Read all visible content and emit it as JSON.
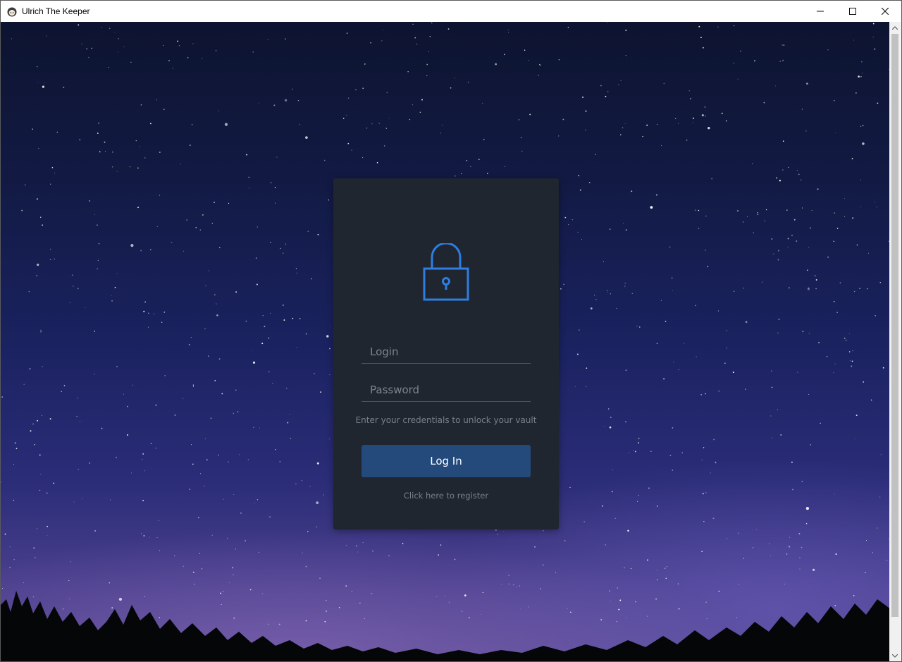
{
  "window": {
    "title": "Ulrich The Keeper",
    "controls": {
      "minimize_icon": "minimize-icon",
      "maximize_icon": "maximize-icon",
      "close_icon": "close-icon"
    }
  },
  "login_card": {
    "lock_icon": "lock-icon",
    "accent_color": "#2f7de1",
    "login_placeholder": "Login",
    "login_value": "",
    "password_placeholder": "Password",
    "password_value": "",
    "hint": "Enter your credentials to unlock your vault",
    "submit_label": "Log In",
    "register_link": "Click here to register"
  },
  "colors": {
    "card_background": "#1f262f",
    "button_background": "#234a7b",
    "muted_text": "#7b8087"
  }
}
